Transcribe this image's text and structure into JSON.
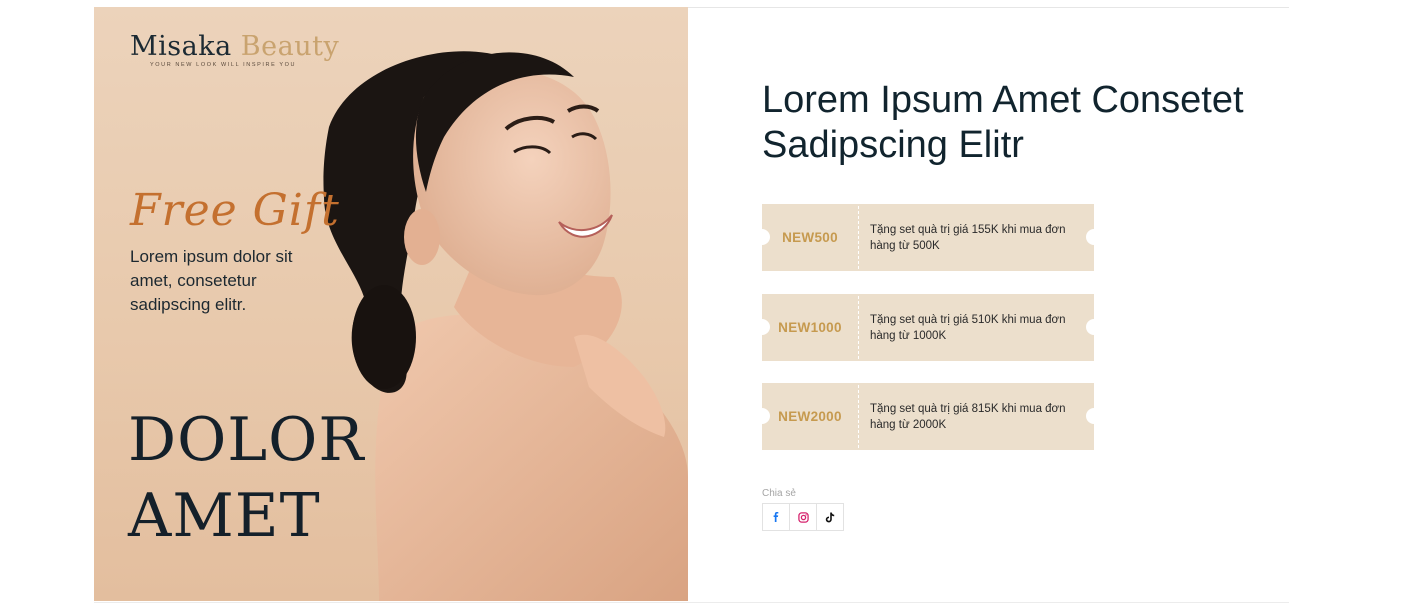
{
  "banner": {
    "brand_main": "Misaka",
    "brand_accent": "Beauty",
    "brand_tagline": "YOUR NEW LOOK WILL INSPIRE YOU",
    "free_gift": "Free Gift",
    "description": "Lorem ipsum dolor sit amet, consetetur sadipscing elitr.",
    "headline_line1": "DOLOR",
    "headline_line2": "AMET"
  },
  "product": {
    "title": "Lorem Ipsum Amet Consetet Sadipscing Elitr"
  },
  "coupons": [
    {
      "code": "NEW500",
      "description": "Tặng set quà trị giá 155K khi mua đơn hàng từ 500K"
    },
    {
      "code": "NEW1000",
      "description": "Tặng set quà trị giá 510K khi mua đơn hàng từ 1000K"
    },
    {
      "code": "NEW2000",
      "description": "Tặng set quà trị giá 815K khi mua đơn hàng từ 2000K"
    }
  ],
  "share": {
    "label": "Chia sẻ",
    "icons": [
      "facebook-icon",
      "instagram-icon",
      "tiktok-icon"
    ]
  },
  "colors": {
    "banner_bg": "#e8c9ac",
    "accent_orange": "#c4702f",
    "coupon_bg": "#ecdfcc",
    "coupon_code": "#c69a4f",
    "heading": "#11242e"
  }
}
